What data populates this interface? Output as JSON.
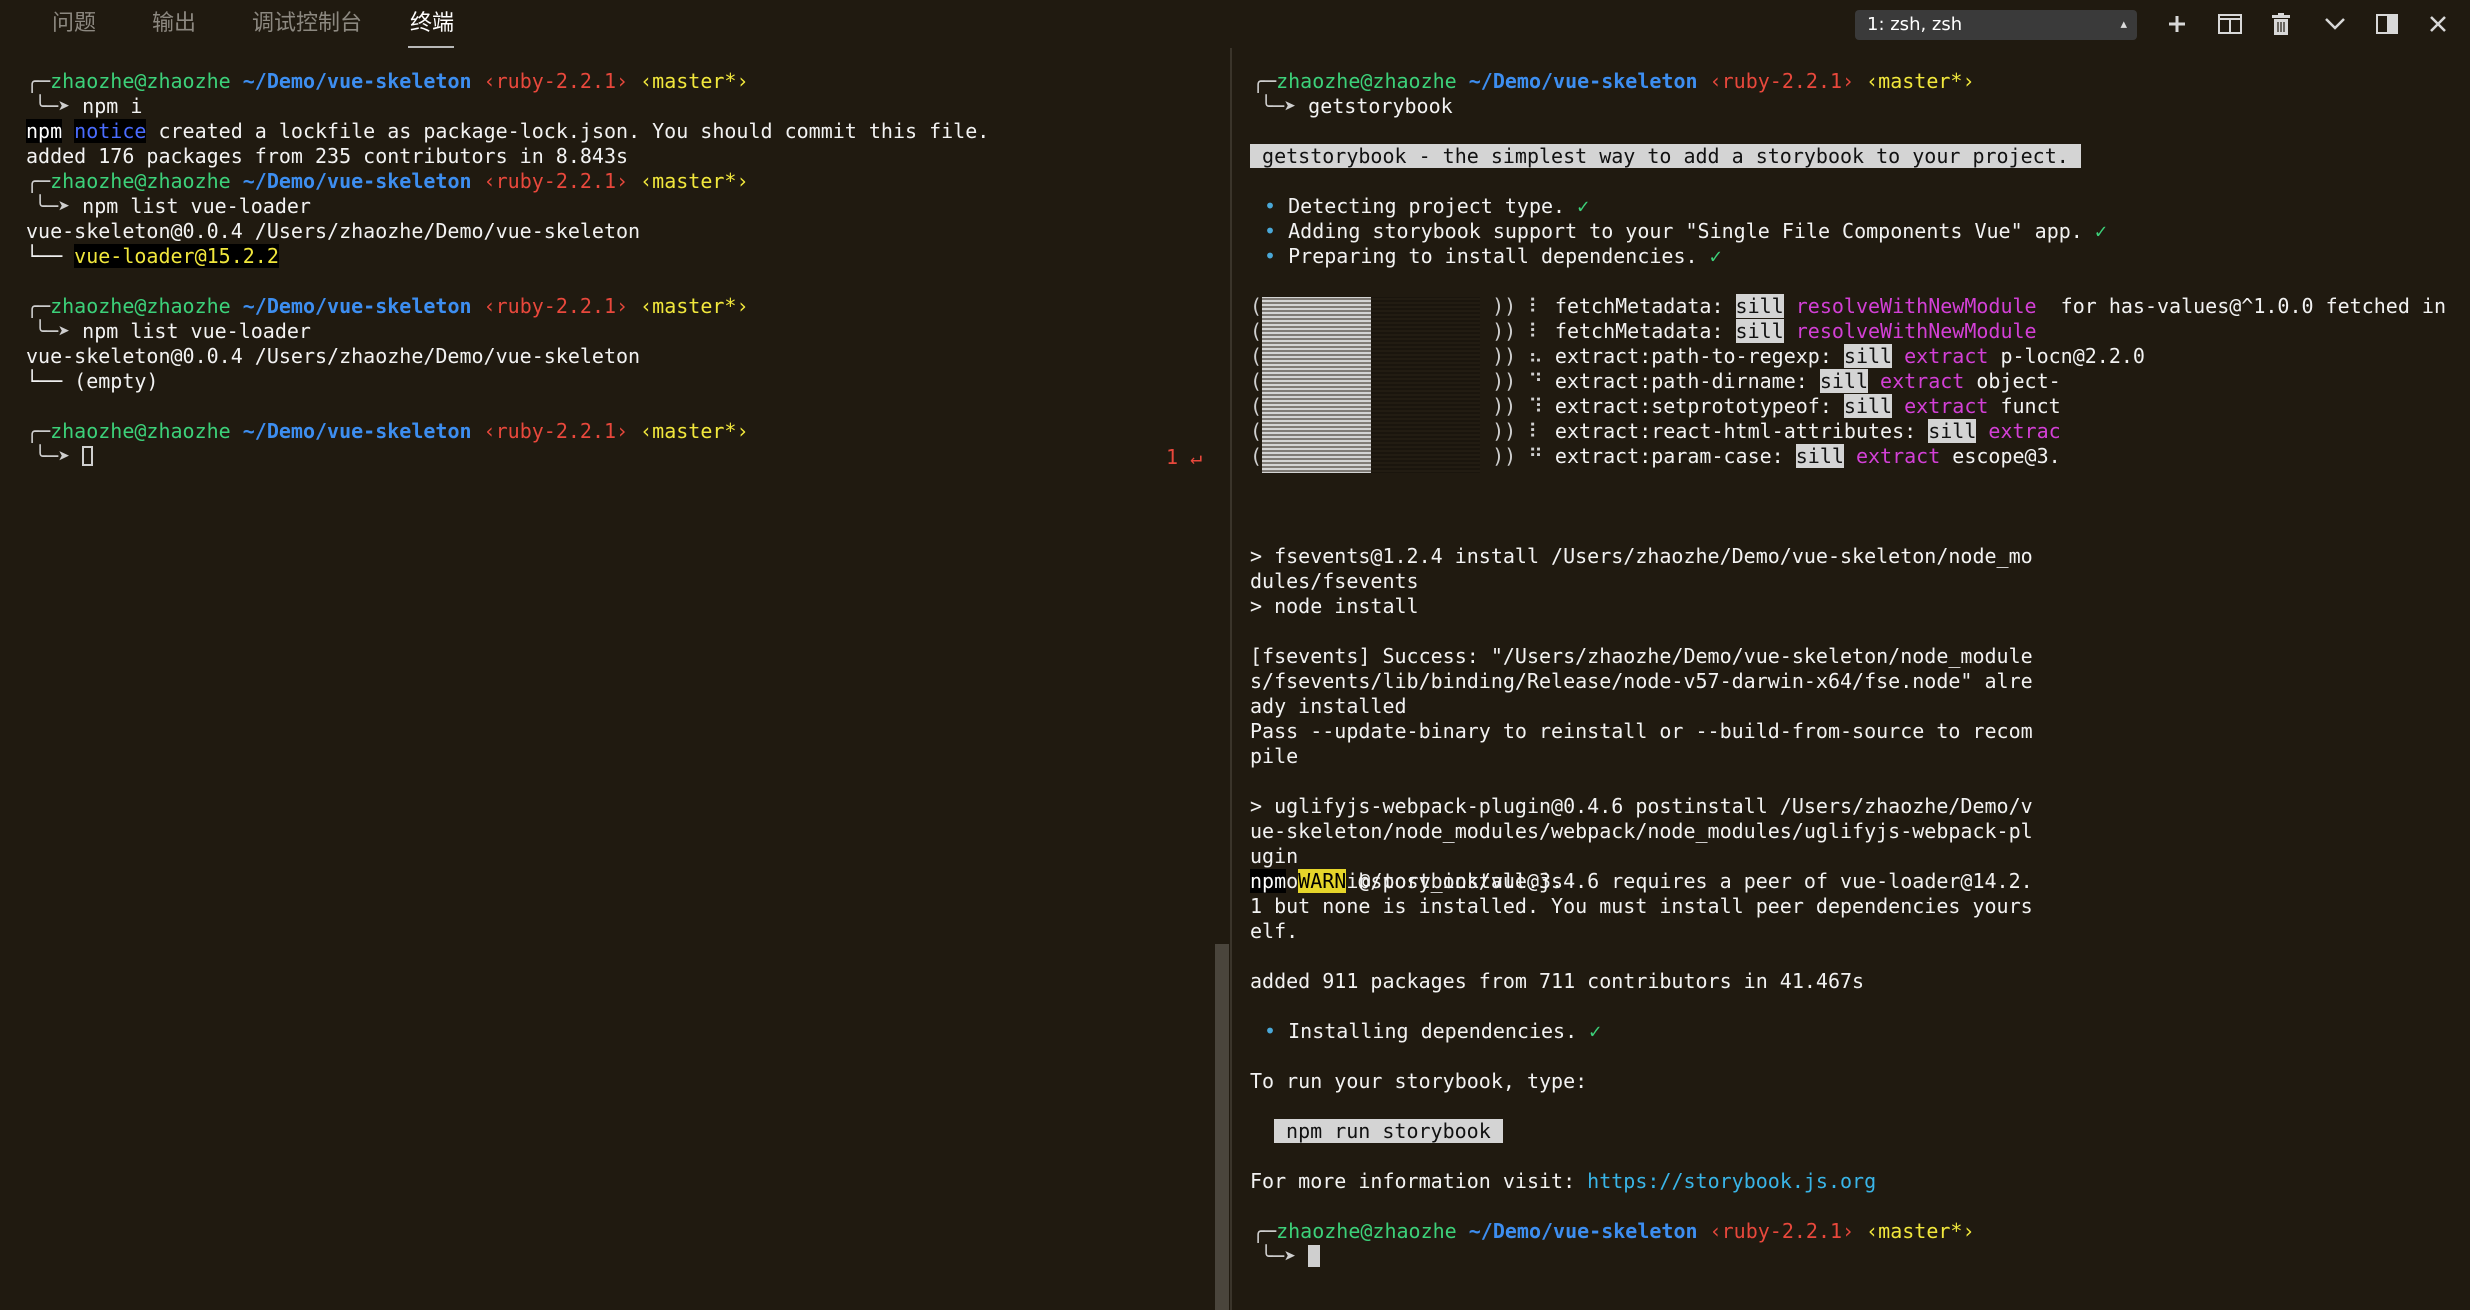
{
  "tabs": [
    {
      "label": "问题"
    },
    {
      "label": "输出"
    },
    {
      "label": "调试控制台"
    },
    {
      "label": "终端",
      "active": true
    }
  ],
  "terminal_select": {
    "value": "1: zsh, zsh"
  },
  "toolbar_icons": [
    "plus-icon",
    "split-icon",
    "trash-icon",
    "chevron-down-icon",
    "maximize-icon",
    "close-icon"
  ],
  "prompt": {
    "user": "zhaozhe@zhaozhe",
    "path": "~/Demo/vue-skeleton",
    "ruby": "‹ruby-2.2.1›",
    "branch": "‹master*›"
  },
  "left": {
    "cmd1": "npm i",
    "npm": "npm",
    "notice": "notice",
    "notice_text": " created a lockfile as package-lock.json. You should commit this file.",
    "added": "added 176 packages from 235 contributors in 8.843s",
    "cmd2": "npm list vue-loader",
    "tree_root": "vue-skeleton@0.0.4 /Users/zhaozhe/Demo/vue-skeleton",
    "tree_branch": "└── ",
    "tree_item": "vue-loader@15.2.2",
    "cmd3": "npm list vue-loader",
    "tree_root2": "vue-skeleton@0.0.4 /Users/zhaozhe/Demo/vue-skeleton",
    "tree_empty": "└── (empty)",
    "return_marker": "1 ↵"
  },
  "right": {
    "cmd": "getstorybook",
    "banner": " getstorybook - the simplest way to add a storybook to your project. ",
    "steps": [
      "Detecting project type.",
      "Adding storybook support to your \"Single File Components Vue\" app.",
      "Preparing to install dependencies."
    ],
    "check": "✓",
    "bullet": "•",
    "fetch_lines": [
      {
        "label": "fetchMetadata:",
        "tag": "sill",
        "action": "resolveWithNewModule",
        "rest": "  for has-values@^1.0.0 fetched in"
      },
      {
        "label": "fetchMetadata:",
        "tag": "sill",
        "action": "resolveWithNewModule",
        "rest": ""
      },
      {
        "label": "extract:path-to-regexp:",
        "tag": "sill",
        "action": "extract",
        "rest": " p-locn@2.2.0"
      },
      {
        "label": "extract:path-dirname:",
        "tag": "sill",
        "action": "extract",
        "rest": " object-"
      },
      {
        "label": "extract:setprototypeof:",
        "tag": "sill",
        "action": "extract",
        "rest": " funct"
      },
      {
        "label": "extract:react-html-attributes:",
        "tag": "sill",
        "action": "extrac",
        "rest": ""
      },
      {
        "label": "extract:param-case:",
        "tag": "sill",
        "action": "extract",
        "rest": " escope@3."
      }
    ],
    "spinners": [
      "⠇",
      "⠇",
      "⠦",
      "⠙",
      "⠹",
      "⠇",
      "⠛"
    ],
    "progress_fraction": 0.5,
    "output": [
      "> fsevents@1.2.4 install /Users/zhaozhe/Demo/vue-skeleton/node_mo",
      "dules/fsevents",
      "> node install",
      "",
      "[fsevents] Success: \"/Users/zhaozhe/Demo/vue-skeleton/node_module",
      "s/fsevents/lib/binding/Release/node-v57-darwin-x64/fse.node\" alre",
      "ady installed",
      "Pass --update-binary to reinstall or --build-from-source to recom",
      "pile",
      "",
      "> uglifyjs-webpack-plugin@0.4.6 postinstall /Users/zhaozhe/Demo/v",
      "ue-skeleton/node_modules/webpack/node_modules/uglifyjs-webpack-pl",
      "ugin",
      "> node lib/post_install.js"
    ],
    "warn_npm": "npm",
    "warn_tag": "WARN",
    "warn_text": [
      " @storybook/vue@3.4.6 requires a peer of vue-loader@14.2.",
      "1 but none is installed. You must install peer dependencies yours",
      "elf."
    ],
    "added": "added 911 packages from 711 contributors in 41.467s",
    "installing": "Installing dependencies.",
    "run_hint": "To run your storybook, type:",
    "run_cmd": " npm run storybook ",
    "info_prefix": "For more information visit: ",
    "info_link": "https://storybook.js.org"
  },
  "prompt_corner": "╭─",
  "prompt_arrow": "╰─➤ "
}
